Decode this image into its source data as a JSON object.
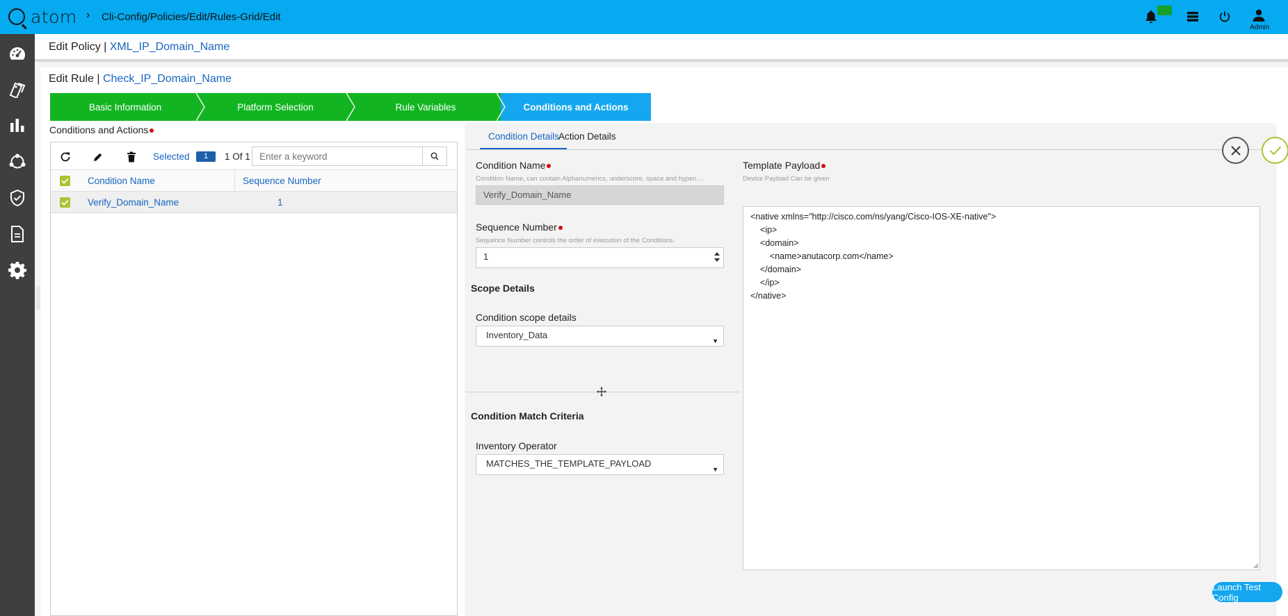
{
  "app": {
    "logo_text": "atom",
    "breadcrumb": "Cli-Config/Policies/Edit/Rules-Grid/Edit",
    "user_label": "Admin"
  },
  "policy": {
    "prefix": "Edit Policy | ",
    "name": "XML_IP_Domain_Name"
  },
  "rule": {
    "prefix": "Edit Rule | ",
    "name": "Check_IP_Domain_Name"
  },
  "wizard": {
    "steps": [
      {
        "label": "Basic Information",
        "state": "done"
      },
      {
        "label": "Platform Selection",
        "state": "done"
      },
      {
        "label": "Rule Variables",
        "state": "done"
      },
      {
        "label": "Conditions and Actions",
        "state": "active"
      }
    ]
  },
  "conditions": {
    "section_label": "Conditions and Actions",
    "selected_label": "Selected",
    "selected_count": "1",
    "page_count": "1 Of 1",
    "search_placeholder": "Enter a keyword",
    "columns": [
      "Condition Name",
      "Sequence Number"
    ],
    "rows": [
      {
        "name": "Verify_Domain_Name",
        "sequence": "1",
        "checked": true
      }
    ]
  },
  "detail": {
    "tabs": [
      "Condition Details",
      "Action Details"
    ],
    "active_tab": 0,
    "condition_name": {
      "label": "Condition Name",
      "hint": "Condition Name, can contain Alphanumerics, underscore, space and hypen ...",
      "value": "Verify_Domain_Name"
    },
    "sequence_number": {
      "label": "Sequence Number",
      "hint": "Sequence Number controls the order of execution of the Conditions.",
      "value": "1"
    },
    "scope_heading": "Scope Details",
    "scope": {
      "label": "Condition scope details",
      "value": "Inventory_Data"
    },
    "match_heading": "Condition Match Criteria",
    "operator": {
      "label": "Inventory Operator",
      "value": "MATCHES_THE_TEMPLATE_PAYLOAD"
    },
    "template_payload": {
      "label": "Template Payload",
      "hint": "Device Payload Can be given",
      "value": "<native xmlns=\"http://cisco.com/ns/yang/Cisco-IOS-XE-native\">\n    <ip>\n    <domain>\n        <name>anutacorp.com</name>\n    </domain>\n    </ip>\n</native>"
    },
    "launch_button": "Launch Test Config"
  },
  "colors": {
    "topbar": "#05aaf0",
    "sidebar": "#3f3f3f",
    "step_done": "#12b521",
    "step_active": "#14a7ef",
    "accent": "#1565c0",
    "checkbox": "#a7c432",
    "required": "#d10f0f"
  }
}
